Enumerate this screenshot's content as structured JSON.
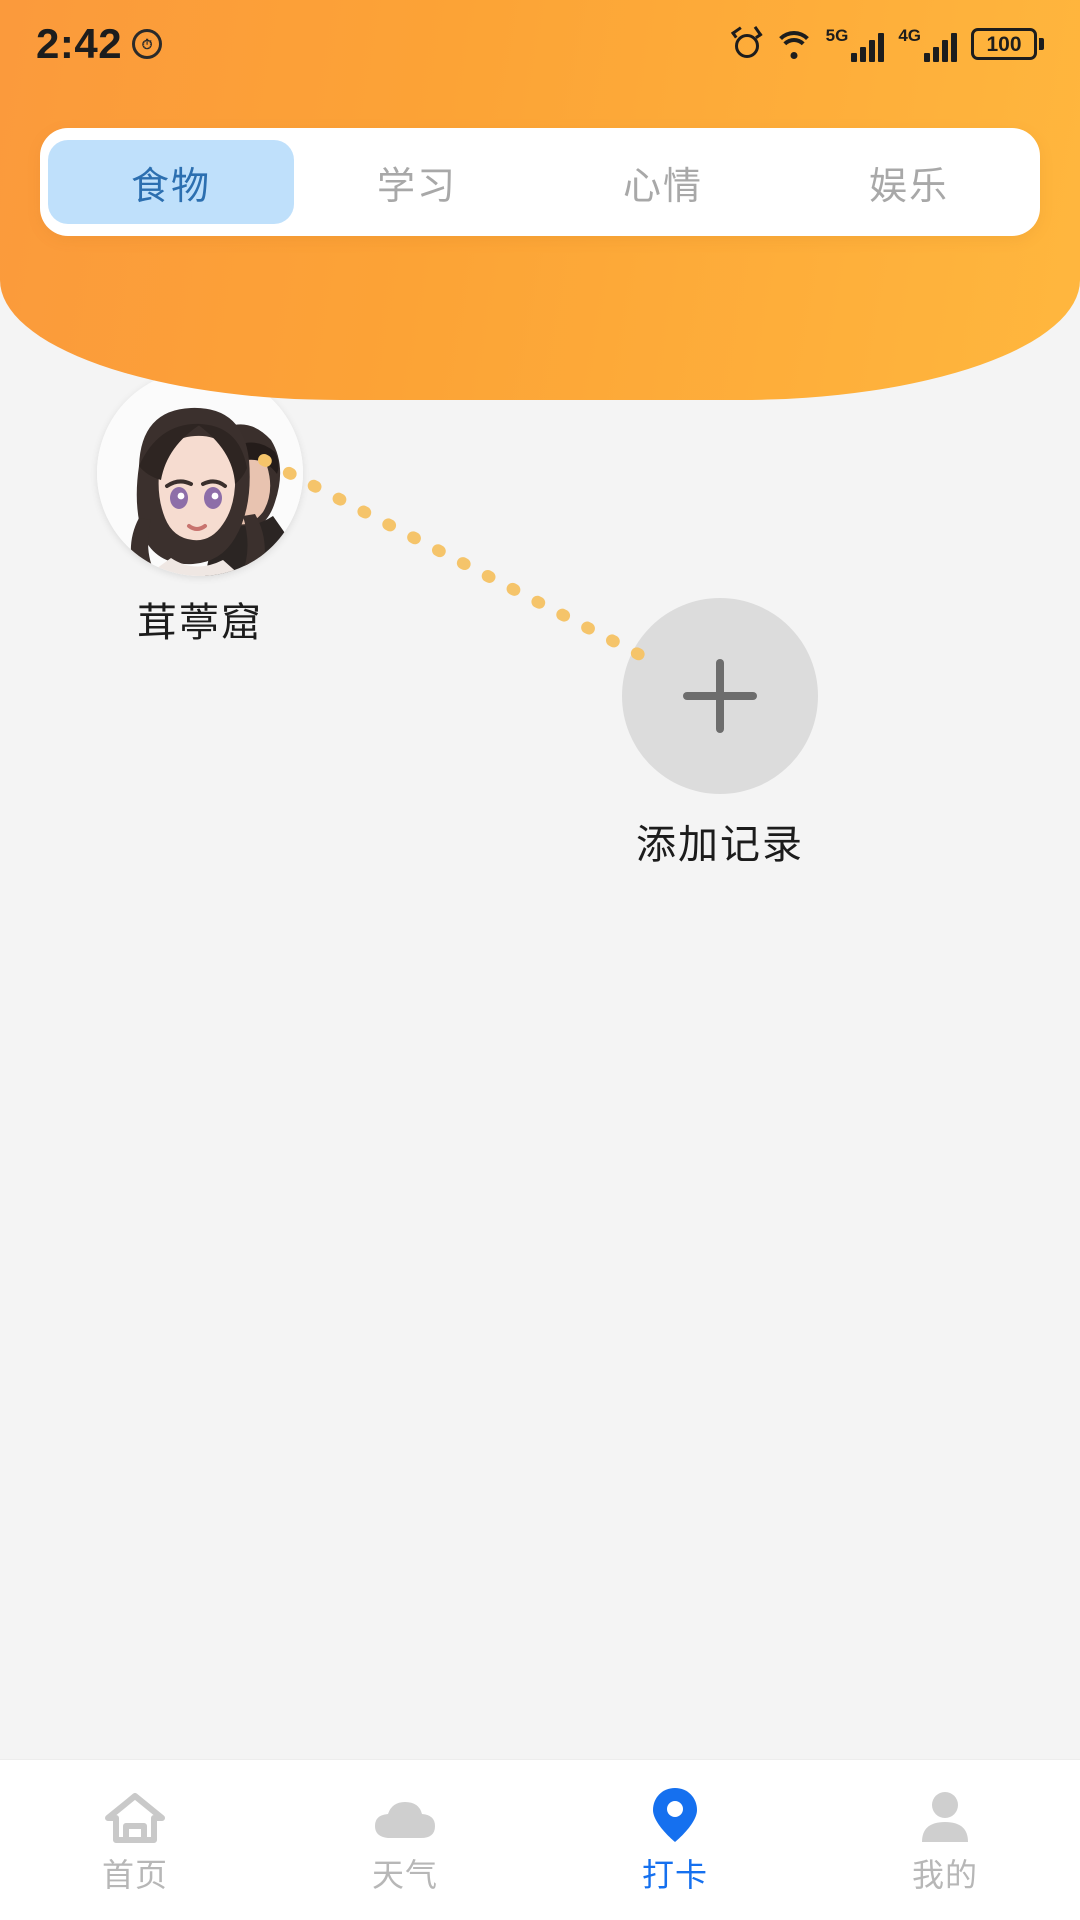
{
  "status_bar": {
    "time": "2:42",
    "alarm_badge_icon": "alarm-clock-small-icon",
    "alarm_icon": "alarm-icon",
    "wifi_icon": "wifi-icon",
    "network_label_1": "5G",
    "network_label_2": "4G",
    "signal_icon_1": "signal-bars-icon",
    "signal_icon_2": "signal-bars-icon",
    "battery_level": "100",
    "battery_icon": "battery-icon"
  },
  "tabs": [
    {
      "label": "食物",
      "active": true
    },
    {
      "label": "学习",
      "active": false
    },
    {
      "label": "心情",
      "active": false
    },
    {
      "label": "娱乐",
      "active": false
    }
  ],
  "content": {
    "record": {
      "label": "茸葶窟",
      "avatar_icon": "user-avatar-image"
    },
    "connector": {
      "style": "dotted",
      "color": "#f5c46a"
    },
    "add": {
      "label": "添加记录",
      "icon": "plus-icon"
    }
  },
  "bottom_nav": [
    {
      "label": "首页",
      "icon": "home-icon",
      "active": false
    },
    {
      "label": "天气",
      "icon": "cloud-icon",
      "active": false
    },
    {
      "label": "打卡",
      "icon": "location-pin-icon",
      "active": true
    },
    {
      "label": "我的",
      "icon": "person-icon",
      "active": false
    }
  ],
  "colors": {
    "header_orange": "#fca336",
    "tab_active_bg": "#bfe0fb",
    "tab_active_text": "#2c6fb0",
    "nav_active": "#1570ef",
    "dot_line": "#f5c46a"
  }
}
